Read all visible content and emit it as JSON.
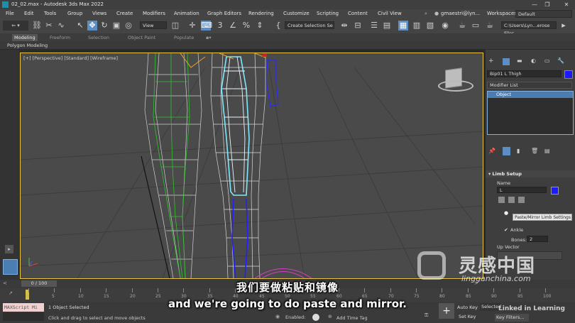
{
  "window": {
    "title": "02_02.max - Autodesk 3ds Max 2022",
    "controls": [
      "—",
      "❐",
      "✕"
    ]
  },
  "menu": {
    "items": [
      "File",
      "Edit",
      "Tools",
      "Group",
      "Views",
      "Create",
      "Modifiers",
      "Animation",
      "Graph Editors",
      "Rendering",
      "Customize",
      "Scripting",
      "Content",
      "Civil View"
    ],
    "user": "gmaestri@lyn...",
    "workspaces_label": "Workspaces:",
    "workspace_value": "Default"
  },
  "toolbar": {
    "view_dropdown": "View",
    "selection_set": "Create Selection Se",
    "path": "C:\\Users\\Lyn...erose Files"
  },
  "ribbon": {
    "tabs": [
      "Modeling",
      "Freeform",
      "Selection",
      "Object Paint",
      "Populate"
    ],
    "sub_label": "Polygon Modeling"
  },
  "viewport": {
    "label": "[+] [Perspective] [Standard] [Wireframe]"
  },
  "command_panel": {
    "object_name": "Bip01 L Thigh",
    "modifier_list": "Modifier List",
    "stack_item": "Object",
    "rollout_title": "Limb Setup",
    "name_label": "Name",
    "name_value": "L",
    "tooltip": "Paste/Mirror Limb Settings",
    "ankle_label": "Ankle",
    "bones_label": "Bones:",
    "bones_value": "2",
    "up_vector_label": "Up Vector"
  },
  "timeline": {
    "frame_display": "0 / 100",
    "ticks": [
      "0",
      "5",
      "10",
      "15",
      "20",
      "25",
      "30",
      "35",
      "40",
      "45",
      "50",
      "55",
      "60",
      "65",
      "70",
      "75",
      "80",
      "85",
      "90",
      "95",
      "100"
    ]
  },
  "status": {
    "script_label": "MAXScript Mi",
    "selected": "1 Object Selected",
    "prompt": "Click and drag to select and move objects",
    "enabled_label": "Enabled:",
    "add_time_tag": "Add Time Tag",
    "auto_key": "Auto Key",
    "set_key": "Set Key",
    "selected_dropdown": "Selected",
    "key_filters": "Key Filters..."
  },
  "subtitles": {
    "chinese": "我们要做粘贴和镜像",
    "english": "and we're going to do paste and mirror."
  },
  "watermark": {
    "cn": "灵感中国",
    "url": "lingganchina.com",
    "linkedin": "Linked in Learning"
  },
  "colors": {
    "accent_blue": "#5b8fc4",
    "viewport_border": "#e8c640",
    "object_color": "#1a1aff"
  }
}
